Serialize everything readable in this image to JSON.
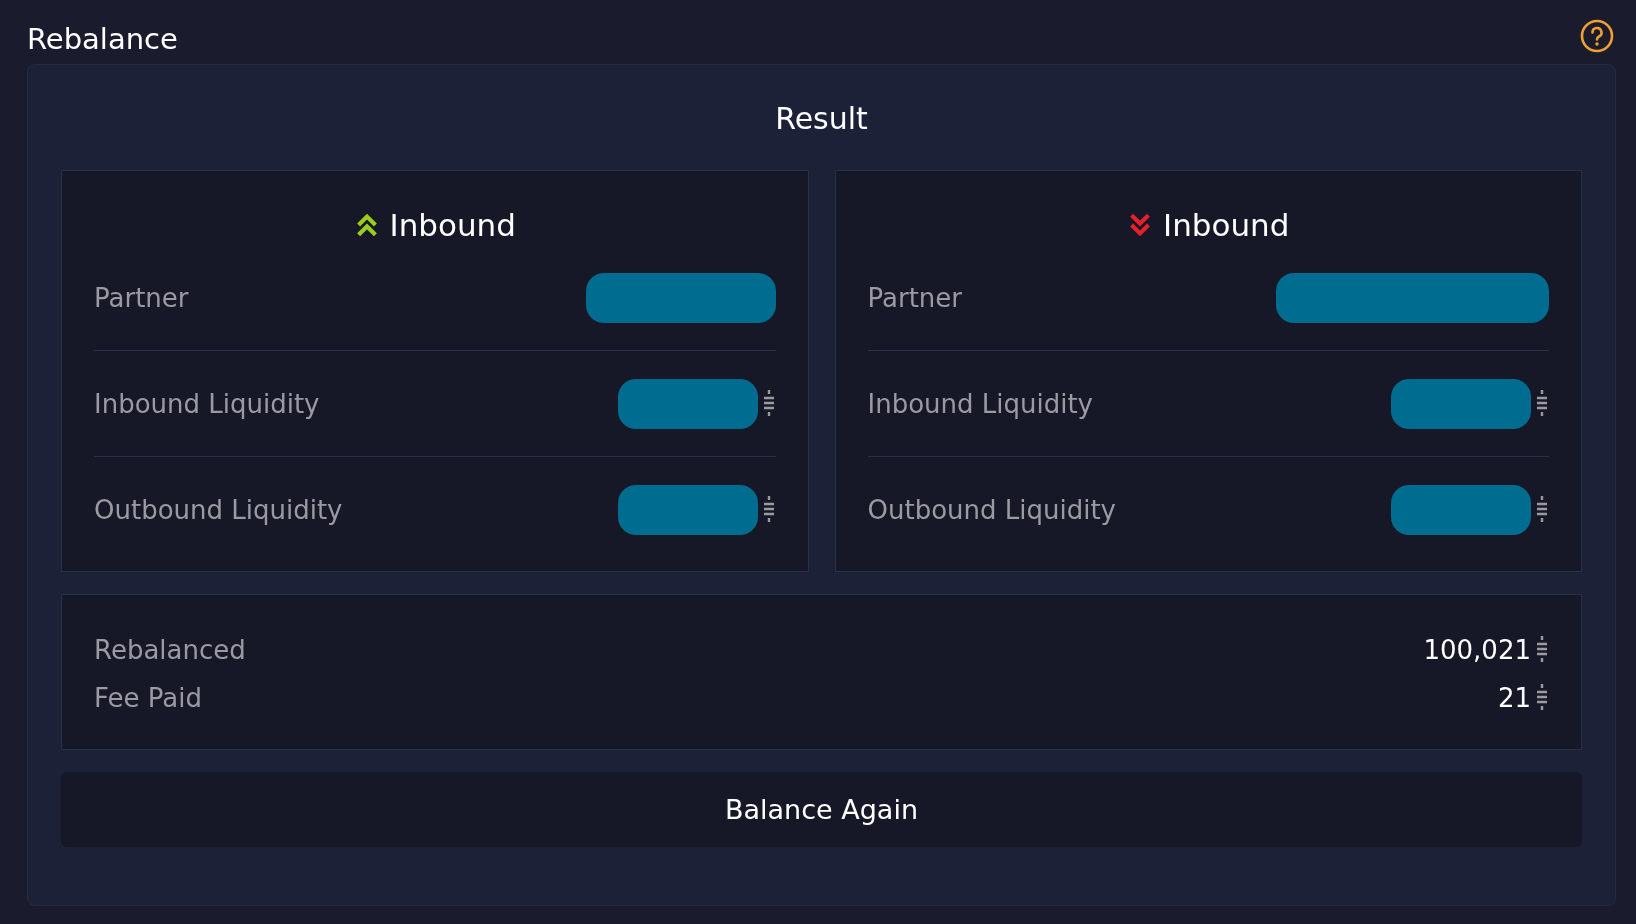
{
  "page": {
    "title": "Rebalance"
  },
  "result": {
    "title": "Result",
    "cards": [
      {
        "heading": "Inbound",
        "kind": "increase",
        "rows": [
          {
            "label": "Partner",
            "kind": "partner"
          },
          {
            "label": "Inbound Liquidity",
            "kind": "amount"
          },
          {
            "label": "Outbound Liquidity",
            "kind": "amount"
          }
        ]
      },
      {
        "heading": "Inbound",
        "kind": "decrease",
        "rows": [
          {
            "label": "Partner",
            "kind": "partner"
          },
          {
            "label": "Inbound Liquidity",
            "kind": "amount"
          },
          {
            "label": "Outbound Liquidity",
            "kind": "amount"
          }
        ]
      }
    ],
    "summary": [
      {
        "label": "Rebalanced",
        "value": "100,021"
      },
      {
        "label": "Fee Paid",
        "value": "21"
      }
    ],
    "button": "Balance Again"
  }
}
